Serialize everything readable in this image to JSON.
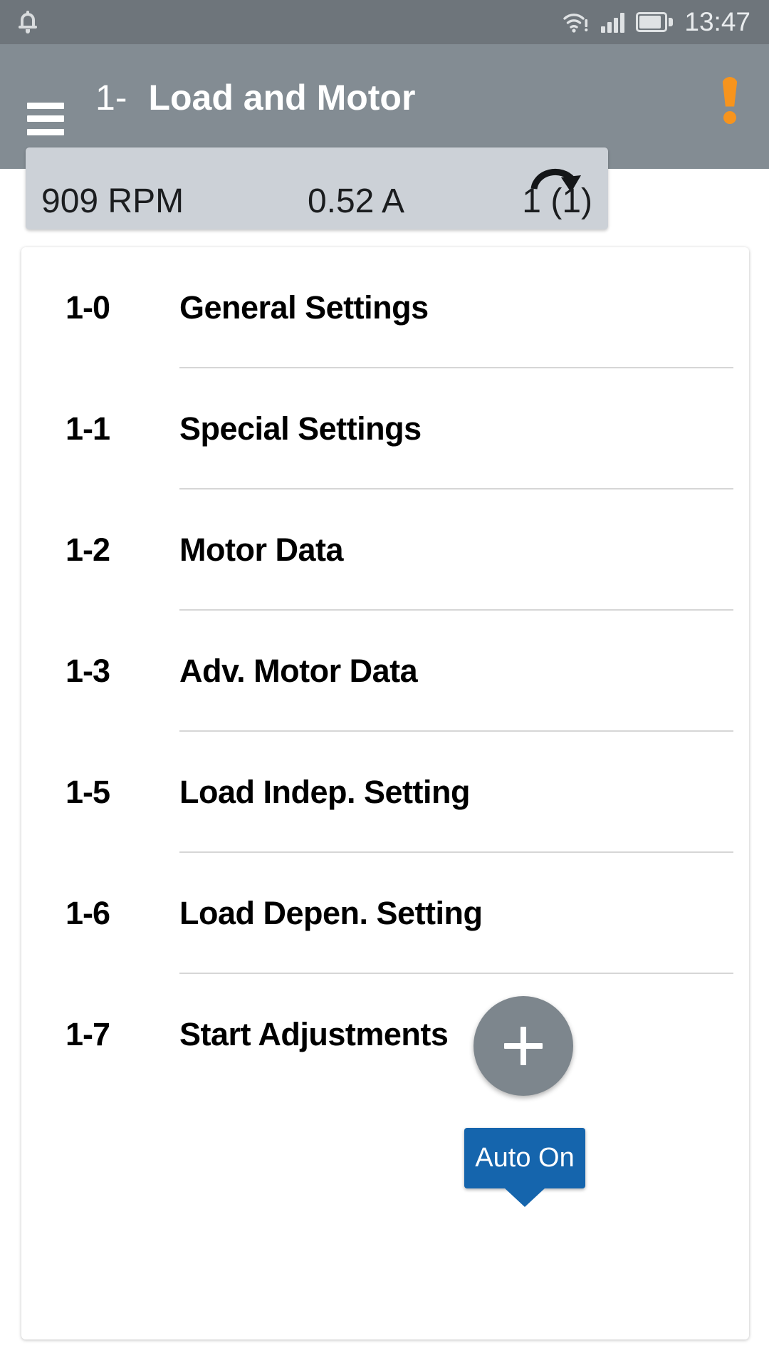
{
  "status_bar": {
    "notification_icon": "bell-icon",
    "wifi_icon": "wifi-alert-icon",
    "signal_icon": "cellular-signal-icon",
    "battery_icon": "battery-icon",
    "time": "13:47"
  },
  "app_bar": {
    "menu_icon": "hamburger-menu-icon",
    "title_number": "1-",
    "title_name": "Load and Motor",
    "alert_icon": "exclamation-warning-icon",
    "alert_color": "#f7941d",
    "background_color": "#838c93"
  },
  "readout": {
    "speed": "909 RPM",
    "current": "0.52 A",
    "counter": "1 (1)",
    "rotation_icon": "clockwise-rotation-arrow-icon",
    "background_color": "#ccd1d7"
  },
  "menu_list": [
    {
      "code": "1-0",
      "label": "General Settings"
    },
    {
      "code": "1-1",
      "label": "Special Settings"
    },
    {
      "code": "1-2",
      "label": "Motor Data"
    },
    {
      "code": "1-3",
      "label": "Adv. Motor Data"
    },
    {
      "code": "1-5",
      "label": "Load Indep. Setting"
    },
    {
      "code": "1-6",
      "label": "Load Depen. Setting"
    },
    {
      "code": "1-7",
      "label": "Start Adjustments"
    }
  ],
  "tooltip": {
    "text": "Auto On",
    "color": "#1565ad"
  },
  "fab": {
    "icon": "plus-icon",
    "color": "#7d868d"
  }
}
